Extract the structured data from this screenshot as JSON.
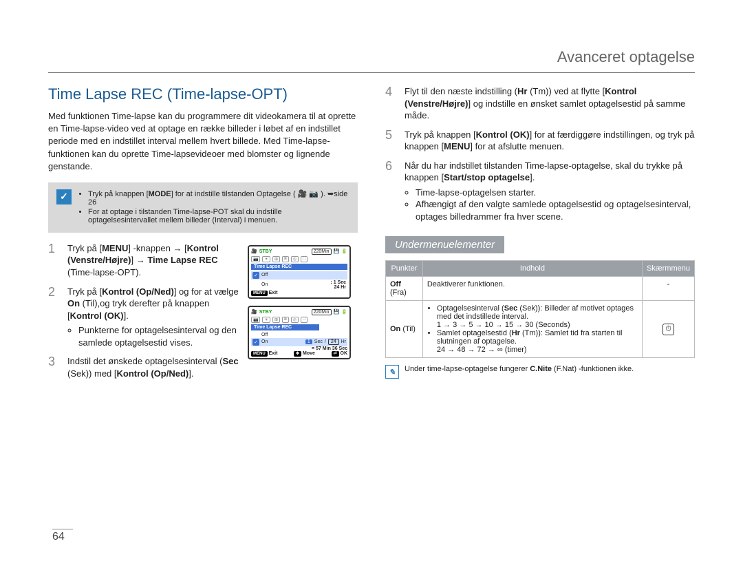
{
  "header": {
    "title": "Avanceret optagelse"
  },
  "h1": "Time Lapse REC (Time-lapse-OPT)",
  "intro": "Med funktionen Time-lapse kan du programmere dit videokamera til at oprette en Time-lapse-video ved at optage en række billeder i løbet af en indstillet periode med en indstillet interval mellem hvert billede. Med Time-lapse-funktionen kan du oprette Time-lapsevideoer med blomster og lignende genstande.",
  "callout": {
    "b1_pre": "Tryk på knappen [",
    "b1_btn": "MODE",
    "b1_post": "] for at indstille tilstanden Optagelse ( 🎥 📷 ). ➥side 26",
    "b2": "For at optage i tilstanden Time-lapse-POT skal du indstille optagelsesintervallet mellem billeder (Interval) i menuen."
  },
  "left_steps": {
    "s1": {
      "p1a": "Tryk på [",
      "p1b": "MENU",
      "p1c": "] -knappen → [",
      "p1d": "Kontrol (Venstre/Højre)",
      "p1e": "] → ",
      "p1f": "Time Lapse REC",
      "p1g": " (Time-lapse-OPT)."
    },
    "s2": {
      "p1a": "Tryk på [",
      "p1b": "Kontrol (Op/Ned)",
      "p1c": "] og for at vælge ",
      "p1d": "On",
      "p1e": " (Til),og tryk derefter på knappen [",
      "p1f": "Kontrol (OK)",
      "p1g": "].",
      "bullet": "Punkterne for optagelsesinterval og den samlede optagelsestid vises."
    },
    "s3": {
      "p1a": "Indstil det ønskede optagelsesinterval (",
      "p1b": "Sec",
      "p1c": " (Sek)) med [",
      "p1d": "Kontrol (Op/Ned)",
      "p1e": "]."
    }
  },
  "right_steps": {
    "s4": {
      "p1a": "Flyt til den næste indstilling (",
      "p1b": "Hr",
      "p1c": " (Tm)) ved at flytte [",
      "p1d": "Kontrol (Venstre/Højre)",
      "p1e": "] og indstille en ønsket samlet optagelsestid på samme måde."
    },
    "s5": {
      "p1a": "Tryk på knappen [",
      "p1b": "Kontrol (OK)",
      "p1c": "] for at færdiggøre indstillingen, og tryk på knappen [",
      "p1d": "MENU",
      "p1e": "] for at afslutte menuen."
    },
    "s6": {
      "p1a": "Når du har indstillet tilstanden Time-lapse-optagelse, skal du trykke på knappen [",
      "p1b": "Start/stop optagelse",
      "p1c": "].",
      "b1": "Time-lapse-optagelsen starter.",
      "b2": "Afhængigt af den valgte samlede optagelsestid og optagelsesinterval, optages billedrammer fra hver scene."
    }
  },
  "submenu_h": "Undermenuelementer",
  "table": {
    "th1": "Punkter",
    "th2": "Indhold",
    "th3": "Skærmmenu",
    "r1c1a": "Off",
    "r1c1b": " (Fra)",
    "r1c2": "Deaktiverer funktionen.",
    "r1c3": "-",
    "r2c1a": "On",
    "r2c1b": " (Til)",
    "r2b1_a": "Optagelsesinterval (",
    "r2b1_b": "Sec",
    "r2b1_c": " (Sek)): Billeder af motivet optages med det indstillede interval.",
    "r2b1_line2": "1 → 3 → 5 → 10 → 15 → 30 (Seconds)",
    "r2b2_a": "Samlet optagelsestid (",
    "r2b2_b": "Hr",
    "r2b2_c": " (Tm)): Samlet tid fra starten til slutningen af optagelse.",
    "r2b2_line2": "24 → 48 → 72 → ∞ (timer)"
  },
  "note": {
    "pre": "Under time-lapse-optagelse fungerer ",
    "b": "C.Nite",
    "post": " (F.Nat) -funktionen ikke."
  },
  "lcd": {
    "stby": "STBY",
    "time": "220Min",
    "title": "Time Lapse REC",
    "off": "Off",
    "on": "On",
    "s1": ": 1 Sec",
    "s2": "  24 Hr",
    "exit": "Exit",
    "move": "Move",
    "ok": "OK",
    "sec_n1": "1",
    "sec_lbl": "Sec",
    "slash": "/",
    "hr_n": "24",
    "hr_lbl": "Hr",
    "eq": "= 57 Min 36 Sec",
    "menu": "MENU"
  },
  "page": "64"
}
